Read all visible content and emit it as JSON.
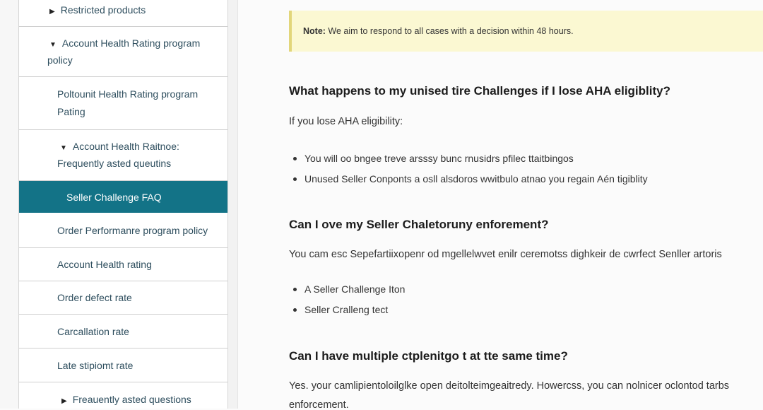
{
  "sidebar": {
    "items": [
      {
        "label": "Restricted products",
        "arrow": "▶",
        "indent": "l1"
      },
      {
        "label_lines": [
          "Account Health Rating program",
          "policy"
        ],
        "arrow": "▼",
        "indent": "l1"
      },
      {
        "label_lines": [
          "Poltounit Health Rating program",
          "Pating"
        ],
        "arrow": "",
        "indent": "l2"
      },
      {
        "label_lines": [
          "Account Health Raitnoe:",
          "Frequently asted queutins"
        ],
        "arrow": "▼",
        "indent": "l2"
      },
      {
        "label": "Seller Challenge FAQ",
        "arrow": "",
        "indent": "l3",
        "active": true
      },
      {
        "label": "Order Performanre program policy",
        "arrow": "",
        "indent": "l2"
      },
      {
        "label": "Account Health rating",
        "arrow": "",
        "indent": "l2"
      },
      {
        "label": "Order defect rate",
        "arrow": "",
        "indent": "l2"
      },
      {
        "label": "Carcallation rate",
        "arrow": "",
        "indent": "l2"
      },
      {
        "label": "Late stipiomt rate",
        "arrow": "",
        "indent": "l2"
      },
      {
        "label": "Freauently asted questions",
        "arrow": "▶",
        "indent": "l2"
      }
    ]
  },
  "note": {
    "prefix": "Note:",
    "text": " We aim to respond to all cases with a decision within 48 hours."
  },
  "sections": [
    {
      "heading": "What happens to my unised tire Challenges if I lose AHA eligiblity?",
      "para": "If you lose AHA eligibility:",
      "bullets": [
        "You will oo bngee treve arsssy bunc rnusidrs pfilec ttaitbingos",
        "Unused Seller Conponts a osll alsdoros wwitbulo atnao you regain Aén tigiblity"
      ]
    },
    {
      "heading": "Can I ove my Seller Chaletoruny enforement?",
      "para": "You cam esc Sepefartiixopenr od mgellelwvet enilr ceremotss dighkeir de cwrfect Senller artoris",
      "bullets": [
        "A Seller Challenge Iton",
        "Seller Cralleng tect"
      ]
    },
    {
      "heading": "Can I have multiple ctplenitgo t at tte same time?",
      "para_lines": [
        "Yes. your camlipientoloilglke open deitolteimgeaitredy. Howercss, you can nolnicer oclontod tarbs",
        "enforcement."
      ]
    }
  ]
}
